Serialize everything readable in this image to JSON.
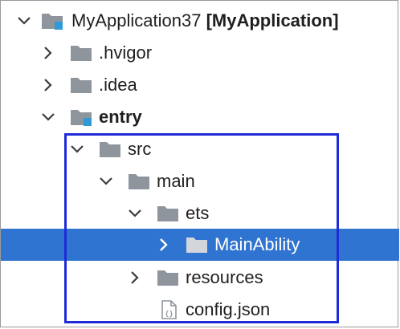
{
  "tree": {
    "root": {
      "name": "MyApplication37",
      "module": "[MyApplication]"
    },
    "hvigor": {
      "name": ".hvigor"
    },
    "idea": {
      "name": ".idea"
    },
    "entry": {
      "name": "entry"
    },
    "src": {
      "name": "src"
    },
    "main": {
      "name": "main"
    },
    "ets": {
      "name": "ets"
    },
    "mainability": {
      "name": "MainAbility"
    },
    "resources": {
      "name": "resources"
    },
    "config": {
      "name": "config.json"
    }
  },
  "colors": {
    "selection": "#2f74d0",
    "highlight_box": "#1f2bd9",
    "folder": "#8f959c",
    "module_badge": "#2e9bd6"
  },
  "icons": {
    "expanded": "chevron-down-icon",
    "collapsed": "chevron-right-icon",
    "folder": "folder-icon",
    "module_folder": "module-folder-icon",
    "json_file": "json-file-icon"
  }
}
